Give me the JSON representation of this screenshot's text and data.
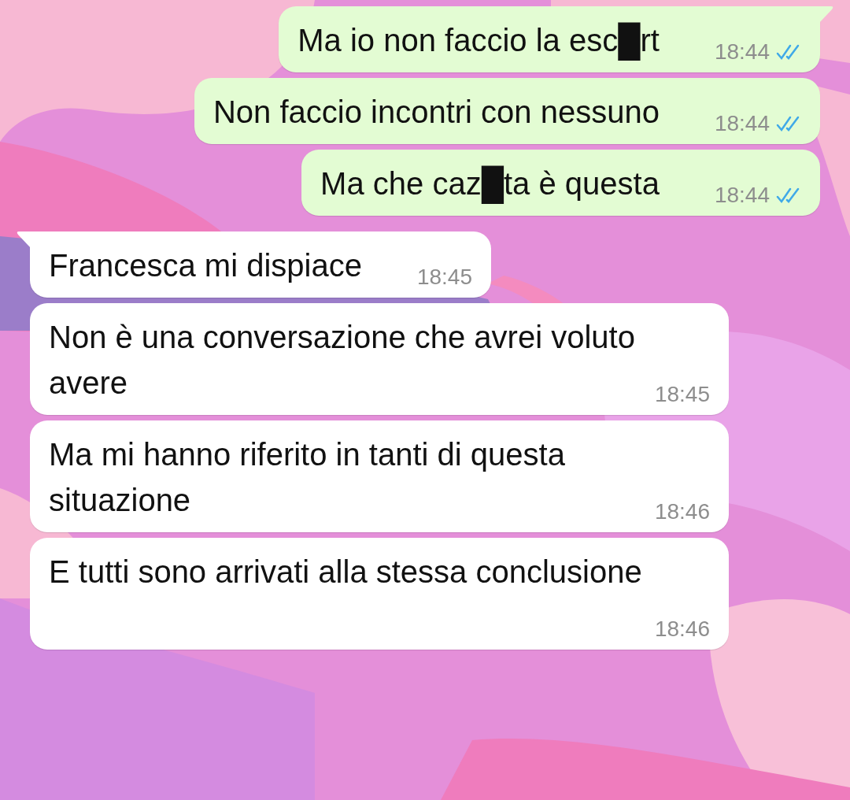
{
  "messages": [
    {
      "kind": "outgoing",
      "tail": true,
      "text": "Ma io non faccio la esc█rt",
      "time": "18:44",
      "read": true
    },
    {
      "kind": "outgoing",
      "tail": false,
      "text": "Non faccio incontri con nessuno",
      "time": "18:44",
      "read": true
    },
    {
      "kind": "outgoing",
      "tail": false,
      "text": "Ma che caz█ta è questa",
      "time": "18:44",
      "read": true
    },
    {
      "kind": "incoming",
      "tail": true,
      "text": "Francesca mi dispiace",
      "time": "18:45"
    },
    {
      "kind": "incoming",
      "tail": false,
      "text": "Non è una conversazione che avrei voluto avere",
      "time": "18:45"
    },
    {
      "kind": "incoming",
      "tail": false,
      "text": "Ma mi hanno riferito in tanti di questa situazione",
      "time": "18:46"
    },
    {
      "kind": "incoming",
      "tail": false,
      "text": "E tutti sono arrivati alla stessa conclusione",
      "time": "18:46"
    }
  ]
}
